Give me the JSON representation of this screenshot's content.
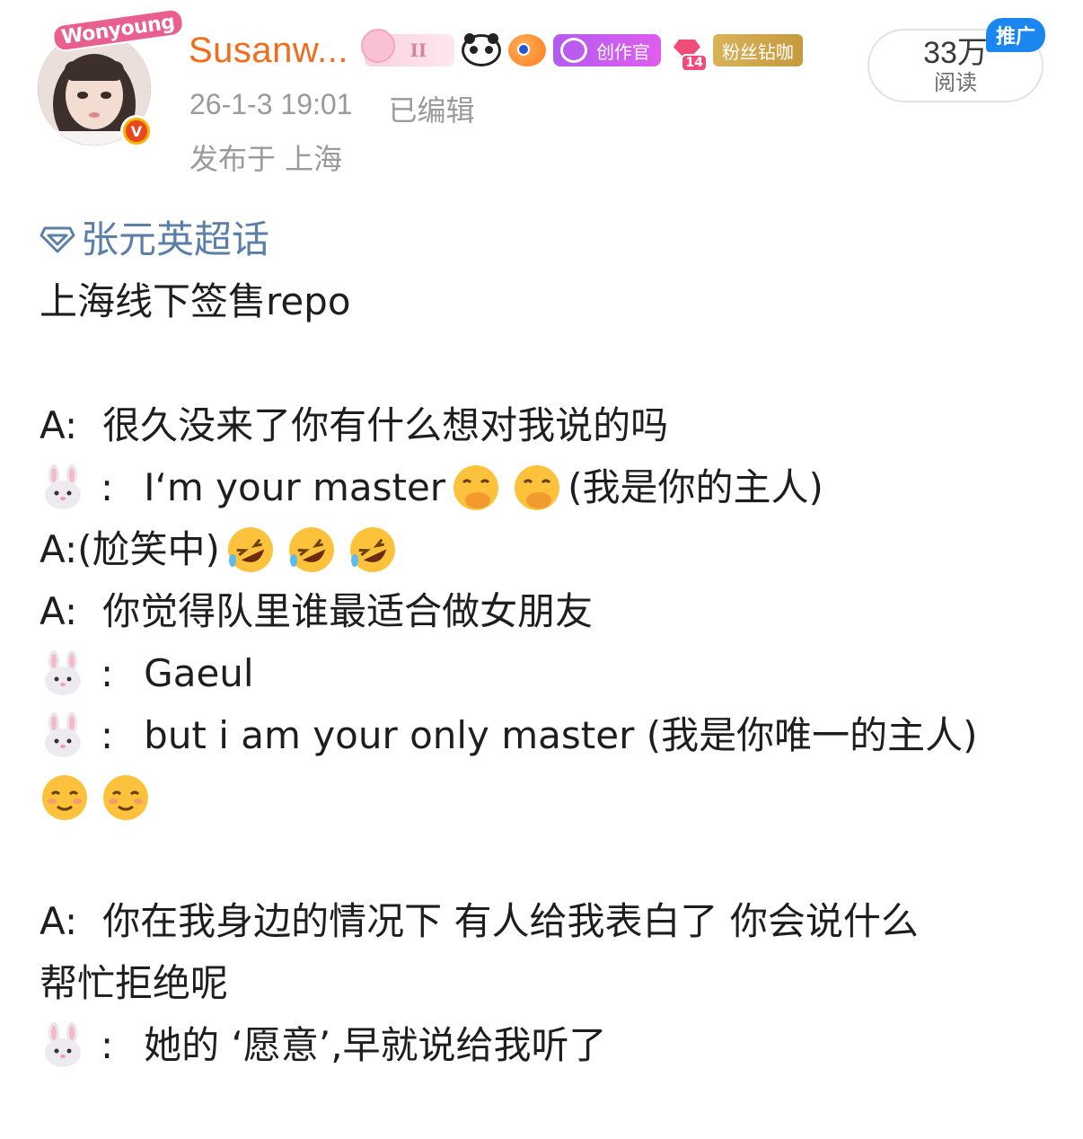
{
  "post": {
    "username": "Susanw...",
    "avatar_sticker": "Wonyoung",
    "badges": {
      "level": "II",
      "creator": "创作官",
      "diamond_level": "14",
      "fans": "粉丝钻咖"
    },
    "time": "26-1-3 19:01",
    "edited": "已编辑",
    "location": "发布于 上海",
    "reads_count": "33万",
    "reads_label": "阅读",
    "promo_tag": "推广"
  },
  "content": {
    "topic": "张元英超话",
    "title": "上海线下签售repo",
    "lines": {
      "l1_speaker": "A:",
      "l1_text": "很久没来了你有什么想对我说的吗",
      "l2_text": "I‘m your master",
      "l2_trans": "(我是你的主人)",
      "l3_speaker": "A:",
      "l3_text": "(尬笑中)",
      "l4_speaker": "A:",
      "l4_text": "你觉得队里谁最适合做女朋友",
      "l5_text": "Gaeul",
      "l6_text": "but i am your only master (我是你唯一的主人)",
      "l8_speaker": "A:",
      "l8_text": "你在我身边的情况下 有人给我表白了 你会说什么",
      "l9_text": "帮忙拒绝呢",
      "l10_text": "她的 ‘愿意’,早就说给我听了",
      "colon": ":"
    }
  },
  "icons": {
    "topic": "diamond-icon",
    "speaker": "rabbit-emoji",
    "hand_over_mouth": "face-hand-over-mouth-emoji",
    "rolling_laughing": "rolling-on-floor-laughing-emoji",
    "smiling": "smiling-face-emoji"
  },
  "colors": {
    "username": "#f26c1c",
    "topic": "#5c7fa8",
    "meta": "#9a9a9a",
    "promo": "#1a87f0"
  }
}
